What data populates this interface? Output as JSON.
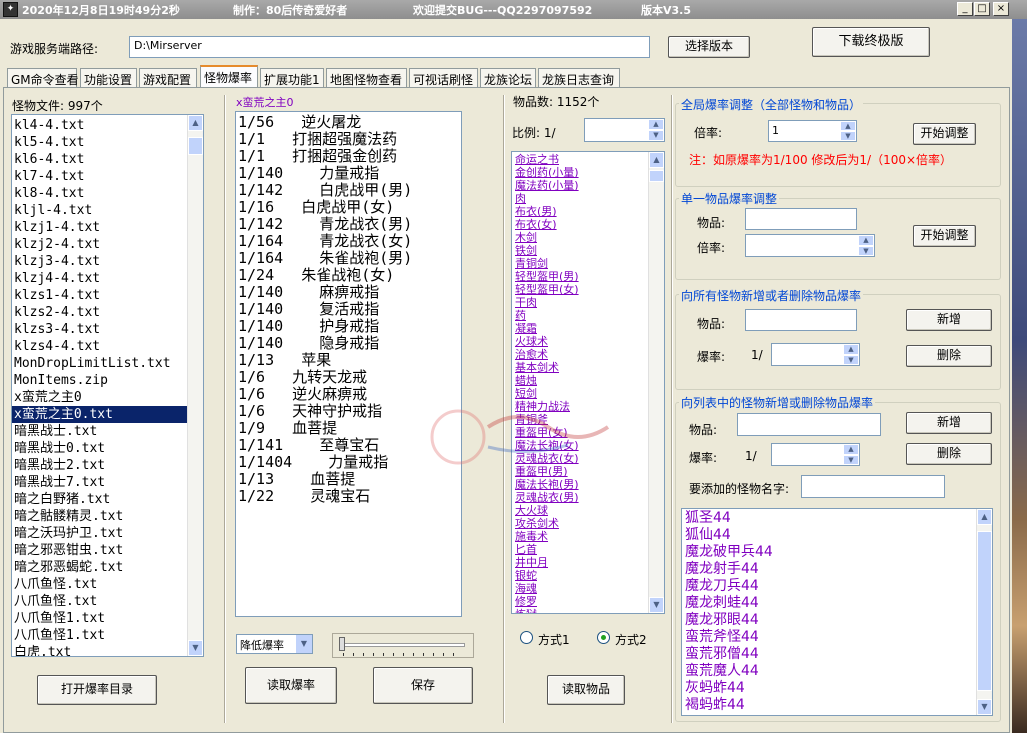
{
  "titlebar": {
    "datetime": "2020年12月8日19时49分2秒",
    "author": "制作：80后传奇爱好者",
    "bug_report": "欢迎提交BUG---QQ2297097592",
    "version": "版本V3.5",
    "controls": [
      "_",
      "□",
      "×"
    ]
  },
  "server_path": {
    "label": "游戏服务端路径:",
    "value": "D:\\Mirserver",
    "select_button": "选择版本",
    "download_button": "下载终极版"
  },
  "tabs": [
    {
      "label": "GM命令查看",
      "active": false
    },
    {
      "label": "功能设置",
      "active": false
    },
    {
      "label": "游戏配置",
      "active": false
    },
    {
      "label": "怪物爆率",
      "active": true
    },
    {
      "label": "扩展功能1",
      "active": false
    },
    {
      "label": "地图怪物查看",
      "active": false
    },
    {
      "label": "可视话刷怪",
      "active": false
    },
    {
      "label": "龙族论坛",
      "active": false
    },
    {
      "label": "龙族日志查询",
      "active": false
    }
  ],
  "monster_files": {
    "label": "怪物文件: 997个",
    "items": [
      "kl4-4.txt",
      "kl5-4.txt",
      "kl6-4.txt",
      "kl7-4.txt",
      "kl8-4.txt",
      "kljl-4.txt",
      "klzj1-4.txt",
      "klzj2-4.txt",
      "klzj3-4.txt",
      "klzj4-4.txt",
      "klzs1-4.txt",
      "klzs2-4.txt",
      "klzs3-4.txt",
      "klzs4-4.txt",
      "MonDropLimitList.txt",
      "MonItems.zip",
      "x蛮荒之主0",
      "x蛮荒之主0.txt",
      "暗黑战士.txt",
      "暗黑战士0.txt",
      "暗黑战士2.txt",
      "暗黑战士7.txt",
      "暗之白野猪.txt",
      "暗之骷髅精灵.txt",
      "暗之沃玛护卫.txt",
      "暗之邪恶钳虫.txt",
      "暗之邪恶蝎蛇.txt",
      "八爪鱼怪.txt",
      "八爪鱼怪.txt",
      "八爪鱼怪1.txt",
      "八爪鱼怪1.txt",
      "白虎.txt"
    ],
    "selected_index": 17,
    "open_button": "打开爆率目录"
  },
  "drop_editor": {
    "title": "x蛮荒之主0",
    "lines": [
      "1/56   逆火屠龙",
      "1/1   打捆超强魔法药",
      "1/1   打捆超强金创药",
      "1/140    力量戒指",
      "1/142    白虎战甲(男)",
      "1/16   白虎战甲(女)",
      "1/142    青龙战衣(男)",
      "1/164    青龙战衣(女)",
      "1/164    朱雀战袍(男)",
      "1/24   朱雀战袍(女)",
      "1/140    麻痹戒指",
      "1/140    复活戒指",
      "1/140    护身戒指",
      "1/140    隐身戒指",
      "1/13   苹果",
      "1/6   九转天龙戒",
      "1/6   逆火麻痹戒",
      "1/6   天神守护戒指",
      "1/9   血菩提",
      "1/141    至尊宝石",
      "1/1404    力量戒指",
      "1/13    血菩提",
      "1/22    灵魂宝石"
    ],
    "mode_select": "降低爆率",
    "slider_value": 0,
    "read_button": "读取爆率",
    "save_button": "保存"
  },
  "items_panel": {
    "count_label": "物品数: 1152个",
    "ratio_label": "比例: 1/",
    "ratio_value": "",
    "items": [
      "命运之书",
      "金创药(小量)",
      "魔法药(小量)",
      "肉",
      "布衣(男)",
      "布衣(女)",
      "木剑",
      "铁剑",
      "青铜剑",
      "轻型盔甲(男)",
      "轻型盔甲(女)",
      "干肉",
      "药",
      "凝霜",
      "火球术",
      "治愈术",
      "基本剑术",
      "蜡烛",
      "短剑",
      "精神力战法",
      "青铜斧",
      "重盔甲(女)",
      "魔法长袍(女)",
      "灵魂战衣(女)",
      "重盔甲(男)",
      "魔法长袍(男)",
      "灵魂战衣(男)",
      "大火球",
      "攻杀剑术",
      "施毒术",
      "匕首",
      "井中月",
      "银蛇",
      "海魂",
      "修罗",
      "炼狱"
    ],
    "radio_1": "方式1",
    "radio_2": "方式2",
    "radio_selected": 2,
    "read_items_button": "读取物品"
  },
  "global_adjust": {
    "title": "全局爆率调整（全部怪物和物品）",
    "multiplier_label": "倍率:",
    "multiplier_value": "1",
    "start_button": "开始调整",
    "note": "注：如原爆率为1/100 修改后为1/（100×倍率）"
  },
  "single_adjust": {
    "title": "单一物品爆率调整",
    "item_label": "物品:",
    "item_value": "",
    "multiplier_label": "倍率:",
    "multiplier_value": "",
    "start_button": "开始调整"
  },
  "all_monsters": {
    "title": "向所有怪物新增或者删除物品爆率",
    "item_label": "物品:",
    "item_value": "",
    "rate_label": "爆率:",
    "rate_prefix": "1/",
    "rate_value": "",
    "add_button": "新增",
    "delete_button": "删除"
  },
  "list_monsters": {
    "title": "向列表中的怪物新增或删除物品爆率",
    "item_label": "物品:",
    "item_value": "",
    "rate_label": "爆率:",
    "rate_prefix": "1/",
    "rate_value": "",
    "add_button": "新增",
    "delete_button": "删除",
    "monster_name_label": "要添加的怪物名字:",
    "monster_name_value": "",
    "monsters": [
      "狐圣44",
      "狐仙44",
      "魔龙破甲兵44",
      "魔龙射手44",
      "魔龙刀兵44",
      "魔龙刺蛙44",
      "魔龙邪眼44",
      "蛮荒斧怪44",
      "蛮荒邪僧44",
      "蛮荒魔人44",
      "灰蚂蚱44",
      "褐蚂蚱44"
    ]
  },
  "colors": {
    "window_bg": "#ece9d8",
    "accent_link": "#8000c0",
    "group_title": "#0046d5",
    "note_red": "#ff0000",
    "selection": "#0a246a"
  }
}
